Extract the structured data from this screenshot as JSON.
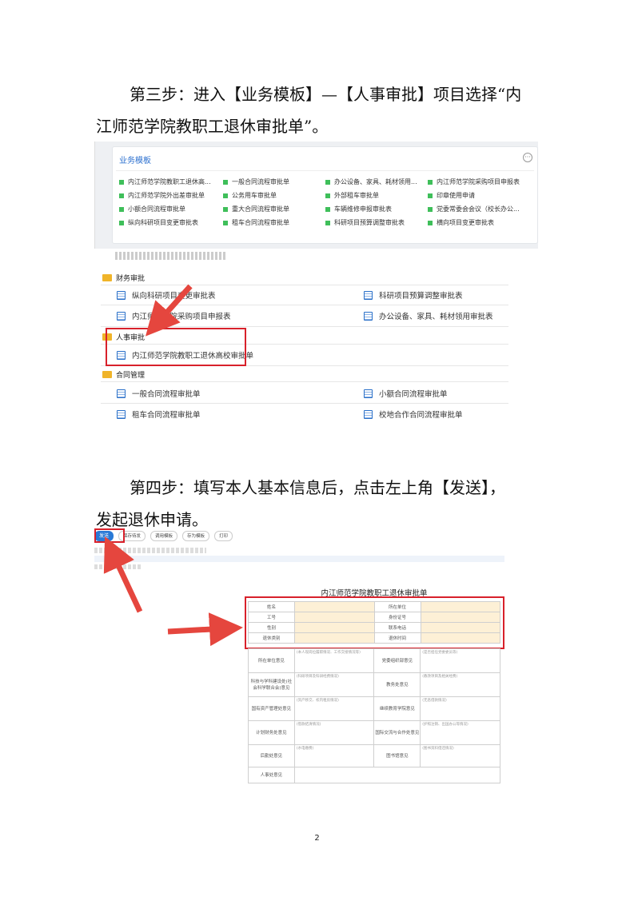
{
  "step3": {
    "line1": "第三步：进入【业务模板】—【人事审批】项目选择“内",
    "line2": "江师范学院教职工退休审批单”。"
  },
  "templates": {
    "title": "业务模板",
    "more": "···",
    "items": [
      "内江师范学院教职工退休高...",
      "一般合同流程审批单",
      "办公设备、家具、耗材领用...",
      "内江师范学院采购项目申报表",
      "内江师范学院外出差审批单",
      "公务用车审批单",
      "外部租车审批单",
      "印章使用申请",
      "小额合同流程审批单",
      "重大合同流程审批单",
      "车辆维修申报审批表",
      "党委常委会会议（校长办公...",
      "纵向科研项目变更审批表",
      "租车合同流程审批单",
      "科研项目预算调整审批表",
      "横向项目变更审批表"
    ]
  },
  "categories": {
    "finance": "财务审批",
    "finance_items": [
      "纵向科研项目变更审批表",
      "科研项目预算调整审批表",
      "内江师范学院采购项目申报表",
      "办公设备、家具、耗材领用审批表"
    ],
    "hr": "人事审批",
    "hr_item": "内江师范学院教职工退休高校审批单",
    "contract": "合同管理",
    "contract_items": [
      "一般合同流程审批单",
      "小额合同流程审批单",
      "租车合同流程审批单",
      "校地合作合同流程审批单"
    ]
  },
  "step4": {
    "line1": "第四步：填写本人基本信息后，点击左上角【发送】，",
    "line2": "发起退休申请。"
  },
  "toolbar": {
    "send": "发送",
    "save": "保存待发",
    "call": "调用模板",
    "save_tpl": "存为模板",
    "print": "打印"
  },
  "form": {
    "title": "内江师范学院教职工退休审批单",
    "fields": [
      [
        "姓名",
        "所在单位"
      ],
      [
        "工号",
        "身份证号"
      ],
      [
        "性别",
        "联系电话"
      ],
      [
        "退休类别",
        "退休时间"
      ]
    ],
    "opinions": [
      [
        "所在单位意见",
        "(本人现岗位履职情况、工作交接情况等)",
        "党委组织部意见",
        "(是否担任党委委员等)"
      ],
      [
        "科技与学科建设处(社会科学联合会)意见",
        "(科研项目及科研经费情况)",
        "教务处意见",
        "(教改项目及相关经费)"
      ],
      [
        "国有资产管理处意见",
        "(资产移交、校内租房情况)",
        "继续教育学院意见",
        "(无息借款情况)"
      ],
      [
        "计划财务处意见",
        "(借款结清情况)",
        "国际交流与合作处意见",
        "(护照注销、出国办公等情况)"
      ],
      [
        "后勤处意见",
        "(水电缴费)",
        "图书馆意见",
        "(图书资料借还情况)"
      ]
    ],
    "last": "人事处意见"
  },
  "page_number": "2"
}
